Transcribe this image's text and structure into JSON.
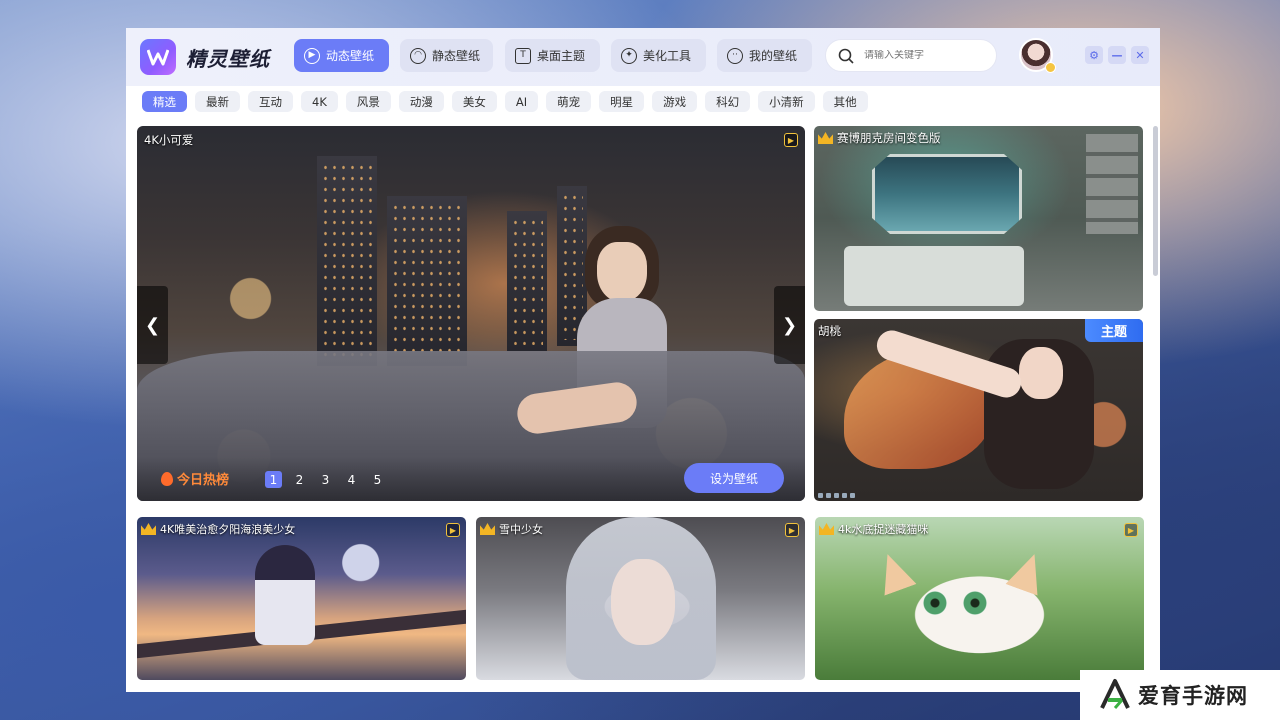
{
  "app": {
    "title": "精灵壁纸"
  },
  "nav": {
    "tabs": [
      {
        "label": "动态壁纸",
        "icon": "dynamic-wallpaper-icon",
        "active": true
      },
      {
        "label": "静态壁纸",
        "icon": "static-wallpaper-icon",
        "active": false
      },
      {
        "label": "桌面主题",
        "icon": "tshirt-icon",
        "active": false
      },
      {
        "label": "美化工具",
        "icon": "tools-icon",
        "active": false
      },
      {
        "label": "我的壁纸",
        "icon": "smile-icon",
        "active": false
      }
    ]
  },
  "search": {
    "placeholder": "请输入关键字"
  },
  "categories": [
    "精选",
    "最新",
    "互动",
    "4K",
    "风景",
    "动漫",
    "美女",
    "AI",
    "萌宠",
    "明星",
    "游戏",
    "科幻",
    "小清新",
    "其他"
  ],
  "hero": {
    "label": "4K小可爱",
    "hot_label": "今日热榜",
    "pages": [
      "1",
      "2",
      "3",
      "4",
      "5"
    ],
    "active_page": 1,
    "prev_symbol": "❮",
    "next_symbol": "❯",
    "set_button": "设为壁纸"
  },
  "side_cards": [
    {
      "label": "赛博朋克房间变色版",
      "crown": true
    },
    {
      "label": "胡桃",
      "crown": false,
      "badge": "主题"
    }
  ],
  "bottom_cards": [
    {
      "label": "4K唯美治愈夕阳海浪美少女",
      "crown": true
    },
    {
      "label": "雪中少女",
      "crown": true
    },
    {
      "label": "4k水底捉迷藏猫咪",
      "crown": true
    }
  ],
  "watermark": {
    "text": "爱育手游网"
  },
  "colors": {
    "accent": "#6b7cf7",
    "theme_badge": "#3d7cf5",
    "hot": "#ff8a3a",
    "crown": "#f3b524"
  }
}
